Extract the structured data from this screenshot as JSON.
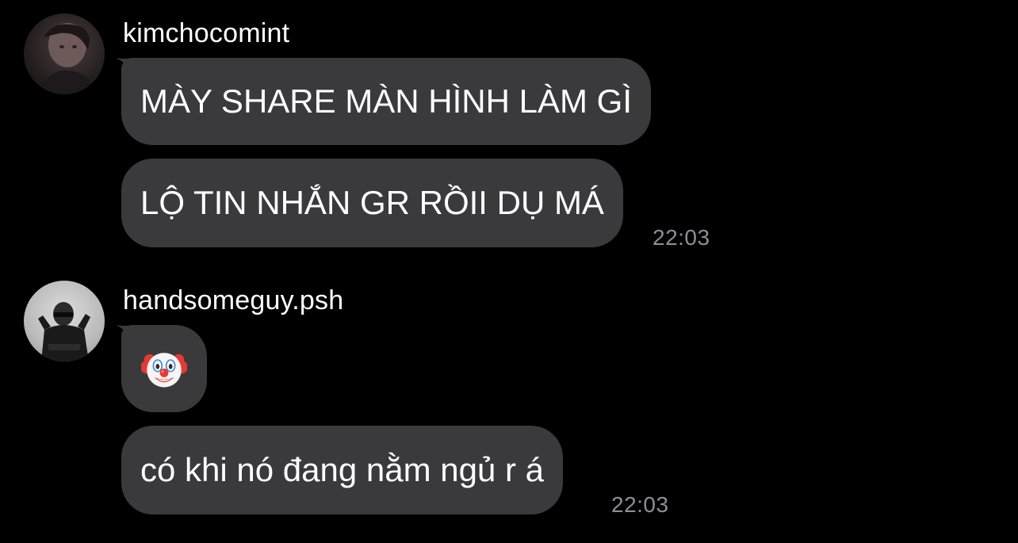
{
  "colors": {
    "background": "#000000",
    "bubble": "#3a3a3c",
    "text": "#ffffff",
    "timestamp": "#8e8e93"
  },
  "messages": [
    {
      "username": "kimchocomint",
      "avatar_icon": "user-avatar",
      "bubbles": [
        {
          "text": "MÀY SHARE MÀN HÌNH LÀM GÌ"
        },
        {
          "text": "LỘ TIN NHẮN GR RỒII DỤ MÁ"
        }
      ],
      "time": "22:03"
    },
    {
      "username": "handsomeguy.psh",
      "avatar_icon": "user-avatar",
      "bubbles": [
        {
          "emoji": "clown-face-emoji"
        },
        {
          "text": "có khi nó đang nằm ngủ r á"
        }
      ],
      "time": "22:03"
    }
  ]
}
